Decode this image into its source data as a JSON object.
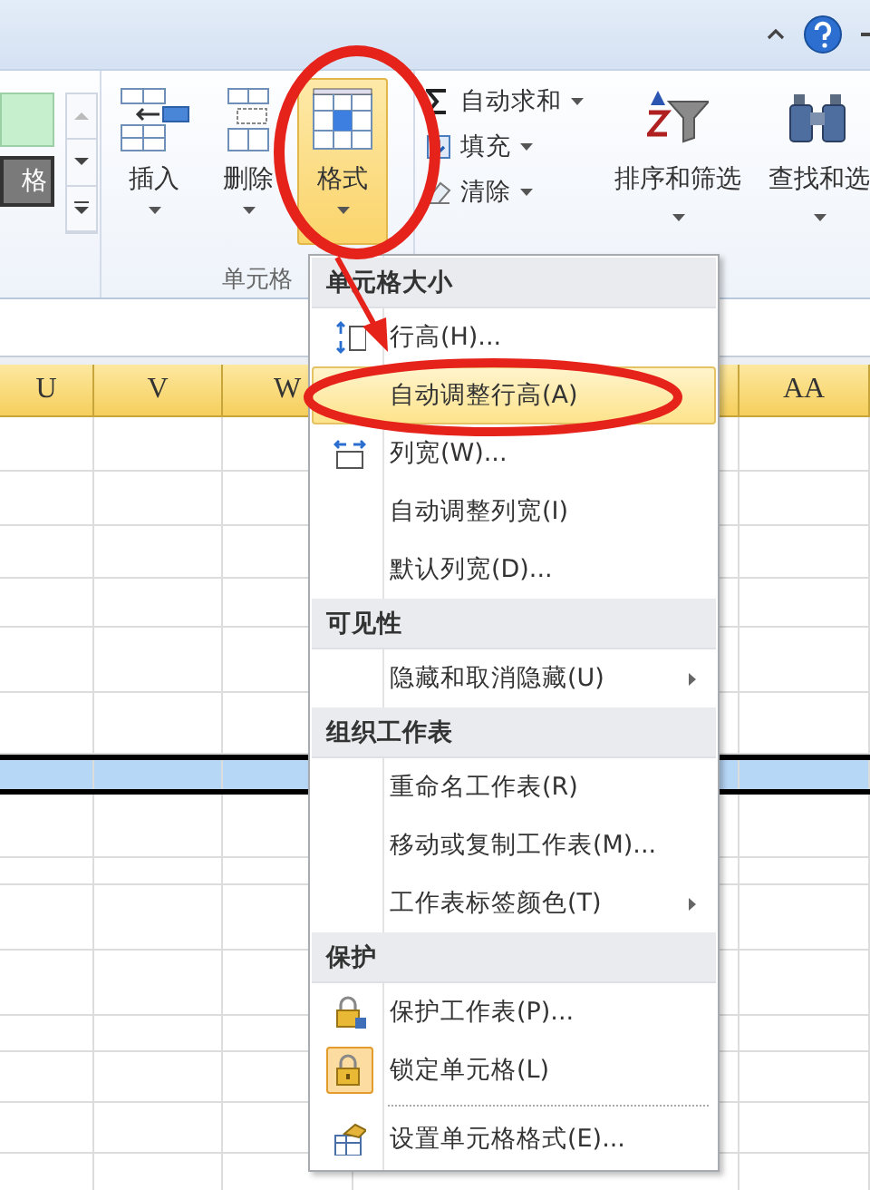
{
  "ribbon": {
    "gallery_cell": "格",
    "cells_group": {
      "label": "单元格",
      "buttons": [
        {
          "label": "插入",
          "selected": false
        },
        {
          "label": "删除",
          "selected": false
        },
        {
          "label": "格式",
          "selected": true
        }
      ]
    },
    "editing": [
      {
        "label": "自动求和"
      },
      {
        "label": "填充"
      },
      {
        "label": "清除"
      }
    ],
    "big_buttons": [
      {
        "label": "排序和筛选"
      },
      {
        "label": "查找和选"
      }
    ]
  },
  "sheet": {
    "columns": [
      "U",
      "V",
      "W",
      "AA"
    ],
    "rows": [
      {
        "selected": false
      },
      {
        "selected": false
      },
      {
        "selected": false
      },
      {
        "selected": false
      },
      {
        "selected": false
      },
      {
        "selected": false
      },
      {
        "selected": true
      },
      {
        "selected": false
      },
      {
        "selected": false
      },
      {
        "selected": false
      },
      {
        "selected": false
      },
      {
        "selected": false
      },
      {
        "selected": false
      },
      {
        "selected": false
      },
      {
        "selected": false
      }
    ]
  },
  "format_menu": {
    "items": [
      {
        "kind": "header",
        "label": "单元格大小"
      },
      {
        "kind": "item",
        "label": "行高(H)...",
        "selected": false,
        "checked": false,
        "submenu": false
      },
      {
        "kind": "item",
        "label": "自动调整行高(A)",
        "selected": true,
        "checked": false,
        "submenu": false
      },
      {
        "kind": "item",
        "label": "列宽(W)...",
        "selected": false,
        "checked": false,
        "submenu": false
      },
      {
        "kind": "item",
        "label": "自动调整列宽(I)",
        "selected": false,
        "checked": false,
        "submenu": false
      },
      {
        "kind": "item",
        "label": "默认列宽(D)...",
        "selected": false,
        "checked": false,
        "submenu": false
      },
      {
        "kind": "header",
        "label": "可见性"
      },
      {
        "kind": "item",
        "label": "隐藏和取消隐藏(U)",
        "selected": false,
        "checked": false,
        "submenu": true
      },
      {
        "kind": "header",
        "label": "组织工作表"
      },
      {
        "kind": "item",
        "label": "重命名工作表(R)",
        "selected": false,
        "checked": false,
        "submenu": false
      },
      {
        "kind": "item",
        "label": "移动或复制工作表(M)...",
        "selected": false,
        "checked": false,
        "submenu": false
      },
      {
        "kind": "item",
        "label": "工作表标签颜色(T)",
        "selected": false,
        "checked": false,
        "submenu": true
      },
      {
        "kind": "header",
        "label": "保护"
      },
      {
        "kind": "item",
        "label": "保护工作表(P)...",
        "selected": false,
        "checked": false,
        "submenu": false
      },
      {
        "kind": "item",
        "label": "锁定单元格(L)",
        "selected": false,
        "checked": true,
        "submenu": false
      },
      {
        "kind": "separator"
      },
      {
        "kind": "item",
        "label": "设置单元格格式(E)...",
        "selected": false,
        "checked": false,
        "submenu": false
      }
    ]
  }
}
